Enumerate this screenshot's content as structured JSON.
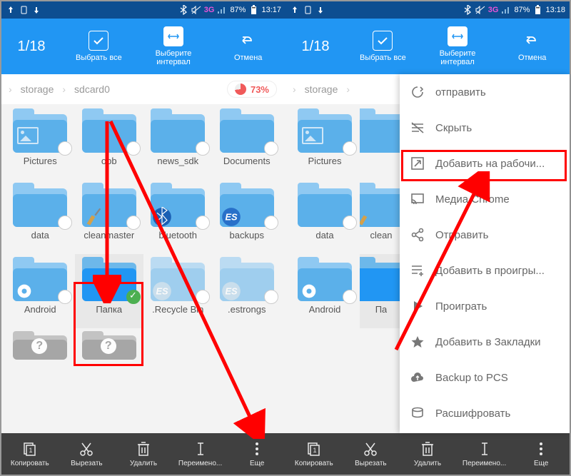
{
  "status": {
    "network": "3G",
    "battery": "87%",
    "time_left": "13:17",
    "time_right": "13:18"
  },
  "toolbar": {
    "counter": "1/18",
    "select_all": "Выбрать все",
    "select_range": "Выберите интервал",
    "cancel": "Отмена"
  },
  "breadcrumb": {
    "seg1": "storage",
    "seg2": "sdcard0",
    "usage": "73%"
  },
  "folders_row1": [
    {
      "name": "Pictures"
    },
    {
      "name": "obb"
    },
    {
      "name": "news_sdk"
    },
    {
      "name": "Documents"
    }
  ],
  "folders_row2": [
    {
      "name": "data"
    },
    {
      "name": "cleanmaster"
    },
    {
      "name": "bluetooth"
    },
    {
      "name": "backups"
    }
  ],
  "folders_row3": [
    {
      "name": "Android"
    },
    {
      "name": "Папка",
      "selected": true
    },
    {
      "name": ".Recycle Bin"
    },
    {
      "name": ".estrongs"
    }
  ],
  "folders_r_row1": [
    {
      "name": "Pictures"
    },
    {
      "name": ""
    },
    {
      "name": ""
    },
    {
      "name": ""
    }
  ],
  "folders_r_row2": [
    {
      "name": "data"
    },
    {
      "name": "clean"
    },
    {
      "name": ""
    },
    {
      "name": ""
    }
  ],
  "folders_r_row3": [
    {
      "name": "Android"
    },
    {
      "name": "Па"
    },
    {
      "name": ""
    },
    {
      "name": ""
    }
  ],
  "bottom": {
    "copy": "Копировать",
    "cut": "Вырезать",
    "delete": "Удалить",
    "rename": "Переимено...",
    "more": "Еще"
  },
  "menu": {
    "send": "отправить",
    "hide": "Скрыть",
    "add_desktop": "Добавить на рабочи...",
    "media_chrome": "Медиа Chrome",
    "share": "Отправить",
    "add_playlist": "Добавить в проигры...",
    "play": "Проиграть",
    "bookmark": "Добавить в Закладки",
    "backup": "Backup to PCS",
    "decrypt": "Расшифровать"
  }
}
